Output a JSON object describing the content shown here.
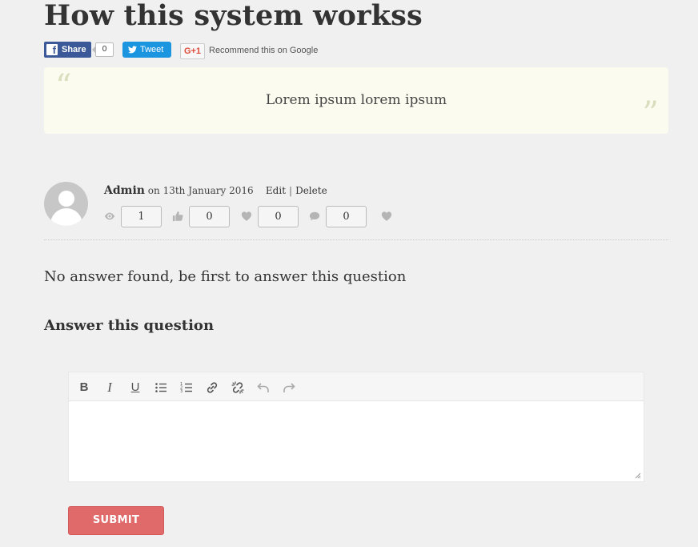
{
  "page": {
    "title": "How this system workss"
  },
  "share": {
    "facebook_label": "Share",
    "facebook_count": "0",
    "twitter_label": "Tweet",
    "google_label": "G+1",
    "google_text": "Recommend this on Google"
  },
  "question": {
    "body": "Lorem ipsum lorem ipsum",
    "open_quote": "“",
    "close_quote": "”"
  },
  "meta": {
    "author": "Admin",
    "date_text": "on 13th January 2016",
    "edit_label": "Edit",
    "separator": "|",
    "delete_label": "Delete"
  },
  "stats": {
    "views": "1",
    "likes": "0",
    "favorites": "0",
    "comments": "0"
  },
  "answers": {
    "empty_message": "No answer found, be first to answer this question",
    "form_heading": "Answer this question"
  },
  "editor": {
    "bold": "B",
    "italic": "I",
    "underline": "U",
    "value": ""
  },
  "form": {
    "submit_label": "SUBMIT"
  },
  "colors": {
    "background": "#f0f0f0",
    "quote_bg": "#fbfbef",
    "submit": "#e06a6a",
    "facebook": "#3b5998",
    "twitter": "#1b95e0",
    "icon_gray": "#b5b5b5"
  },
  "icons": [
    "facebook-icon",
    "twitter-icon",
    "eye-icon",
    "thumbs-up-icon",
    "heart-icon",
    "comment-icon",
    "favorite-heart-icon",
    "link-icon",
    "unlink-icon",
    "undo-icon",
    "redo-icon",
    "bullet-list-icon",
    "numbered-list-icon"
  ]
}
